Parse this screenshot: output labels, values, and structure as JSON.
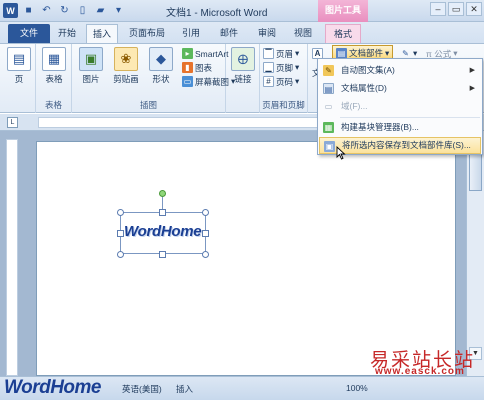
{
  "window": {
    "title": "文档1 - Microsoft Word",
    "context_tab_group": "图片工具",
    "buttons": [
      "–",
      "▭",
      "✕"
    ]
  },
  "qat": {
    "logo": "W"
  },
  "tabs": [
    {
      "label": "文件"
    },
    {
      "label": "开始"
    },
    {
      "label": "插入"
    },
    {
      "label": "页面布局"
    },
    {
      "label": "引用"
    },
    {
      "label": "邮件"
    },
    {
      "label": "审阅"
    },
    {
      "label": "视图"
    },
    {
      "label": "格式"
    }
  ],
  "ribbon": {
    "pages_group": {
      "page_label": "页",
      "group_label": ""
    },
    "tables_group": {
      "table_label": "表格",
      "group_label": "表格"
    },
    "illustrations_group": {
      "picture_label": "图片",
      "clipart_label": "剪贴画",
      "shapes_label": "形状",
      "smartart_label": "SmartArt",
      "chart_label": "图表",
      "screenshot_label": "屏幕截图",
      "group_label": "插图"
    },
    "links_group": {
      "link_label": "链接",
      "group_label": ""
    },
    "header_footer_group": {
      "header_label": "页眉",
      "footer_label": "页脚",
      "pagenum_label": "页码",
      "group_label": "页眉和页脚"
    },
    "text_group": {
      "text_label": "文",
      "quickparts_label": "文档部件"
    },
    "symbols_group": {
      "equation_label": "π 公式"
    }
  },
  "menu": {
    "items": [
      {
        "label": "自动图文集(A)",
        "has_arrow": true,
        "disabled": false
      },
      {
        "label": "文档属性(D)",
        "has_arrow": true,
        "disabled": false
      },
      {
        "label": "域(F)...",
        "has_arrow": false,
        "disabled": true
      },
      {
        "label": "构建基块管理器(B)...",
        "has_arrow": false,
        "disabled": false
      },
      {
        "label": "将所选内容保存到文档部件库(S)...",
        "has_arrow": false,
        "disabled": false,
        "hover": true
      }
    ]
  },
  "document": {
    "image_text": "WordHome"
  },
  "statusbar": {
    "logo": "WordHome",
    "language": "英语(美国)",
    "mode": "插入",
    "zoom": "100%"
  },
  "watermark": {
    "text": "易采站长站",
    "url": "www.easck.com"
  },
  "colors": {
    "file_tab": "#2b579a",
    "context_tab": "#e98fbf",
    "menu_hover": "#fbe29c",
    "logo_blue": "#1b3f93",
    "watermark_red": "#c62828"
  }
}
